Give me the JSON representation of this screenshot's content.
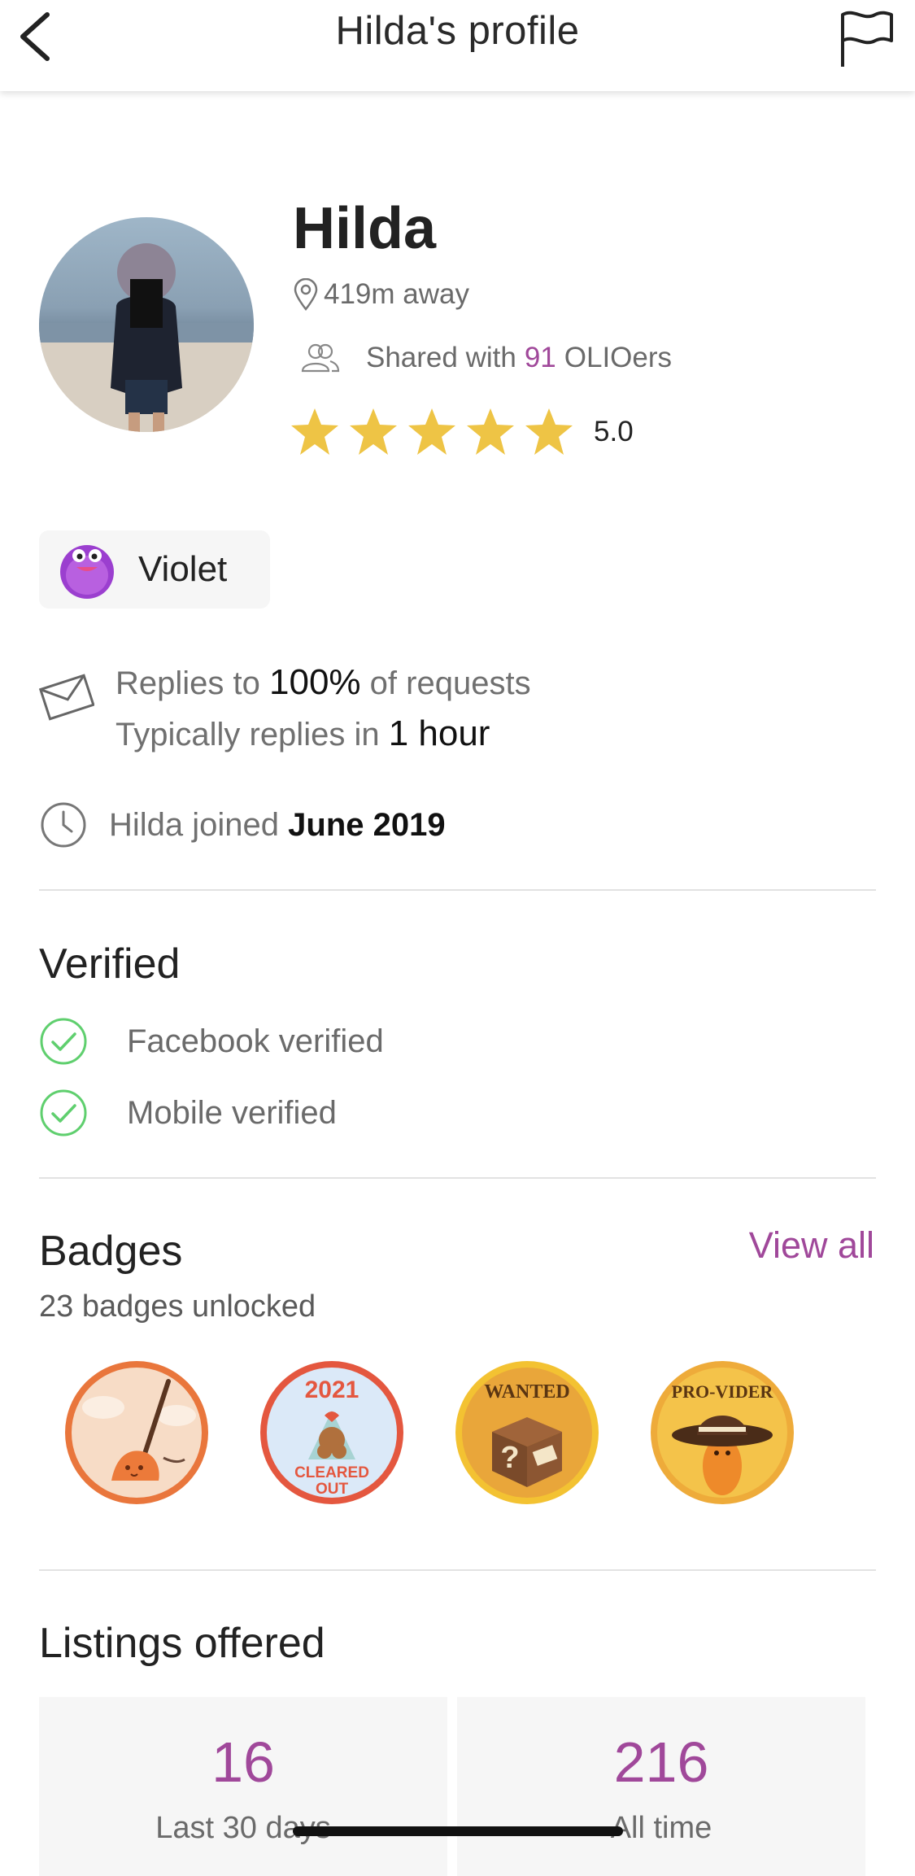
{
  "header": {
    "title": "Hilda's profile"
  },
  "profile": {
    "name": "Hilda",
    "distance": "419m away",
    "shared_prefix": "Shared with",
    "shared_count": "91",
    "shared_suffix": "OLIOers",
    "rating_stars": 5,
    "rating": "5.0"
  },
  "level": {
    "label": "Violet"
  },
  "replies": {
    "line1_prefix": "Replies to",
    "line1_value": "100%",
    "line1_suffix": "of requests",
    "line2_prefix": "Typically replies in",
    "line2_value": "1 hour"
  },
  "joined": {
    "prefix": "Hilda joined",
    "date": "June 2019"
  },
  "verified": {
    "title": "Verified",
    "items": [
      "Facebook verified",
      "Mobile verified"
    ]
  },
  "badges": {
    "title": "Badges",
    "view_all": "View all",
    "count_text": "23 badges unlocked",
    "items": [
      {
        "name": "broom-badge"
      },
      {
        "name": "cleared-out-2021-badge",
        "text": [
          "2021",
          "CLEARED",
          "OUT"
        ]
      },
      {
        "name": "wanted-badge",
        "text": [
          "WANTED"
        ]
      },
      {
        "name": "pro-vider-badge",
        "text": [
          "PRO-VIDER"
        ]
      }
    ]
  },
  "listings": {
    "title": "Listings offered",
    "stats": [
      {
        "value": "16",
        "label": "Last 30 days"
      },
      {
        "value": "216",
        "label": "All time"
      }
    ]
  },
  "colors": {
    "accent": "#a0489a",
    "star": "#eec445",
    "check": "#5fcf6e"
  }
}
